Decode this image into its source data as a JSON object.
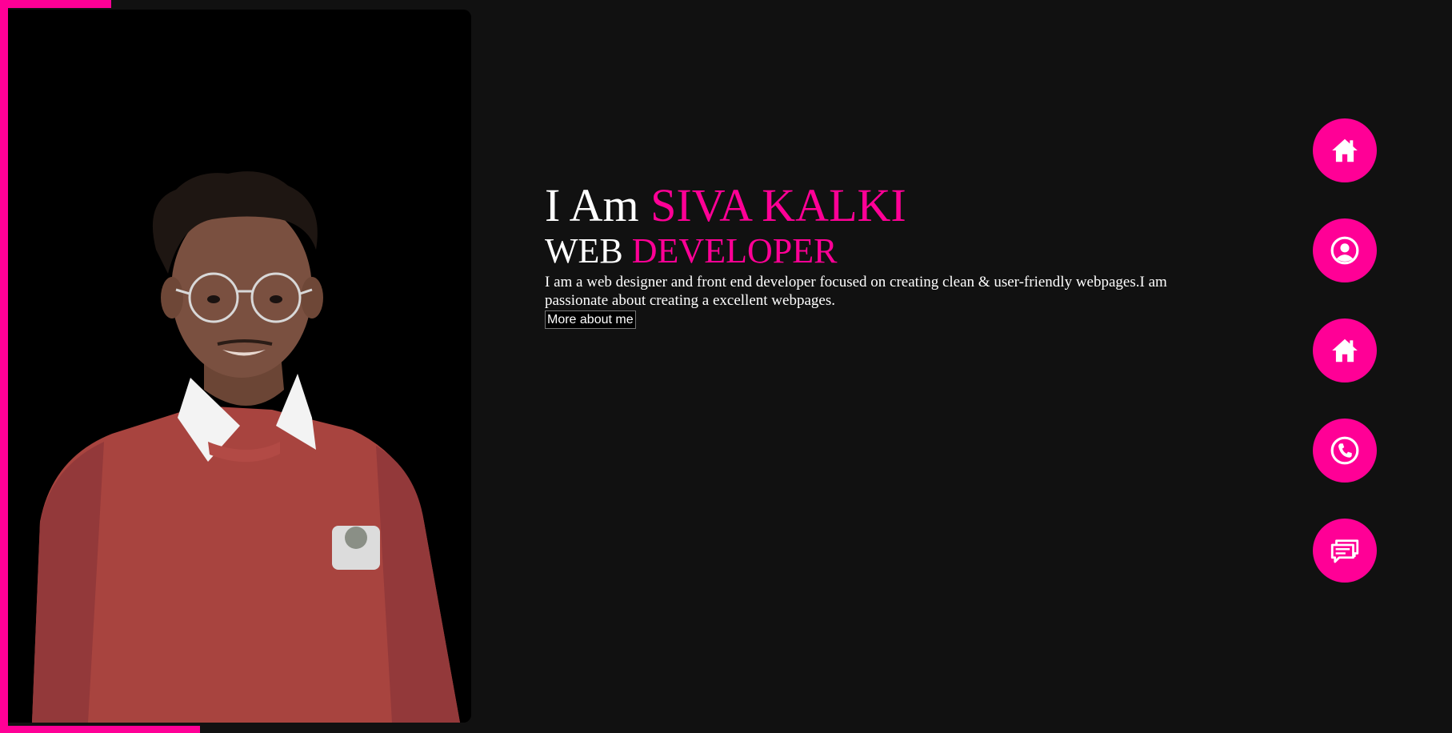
{
  "hero": {
    "greeting": "I Am",
    "name": "SIVA KALKI",
    "role_first": "WEB",
    "role_second": "DEVELOPER",
    "description": "I am a web designer and front end developer focused on creating clean & user-friendly webpages.I am passionate about creating a excellent webpages.",
    "more_button_label": "More about me"
  },
  "colors": {
    "accent": "#ff0096",
    "background": "#111111",
    "photo_background": "#000000",
    "text": "#ffffff"
  },
  "nav": {
    "items": [
      {
        "icon": "home-icon"
      },
      {
        "icon": "user-icon"
      },
      {
        "icon": "home-icon"
      },
      {
        "icon": "phone-icon"
      },
      {
        "icon": "chat-icon"
      }
    ]
  }
}
